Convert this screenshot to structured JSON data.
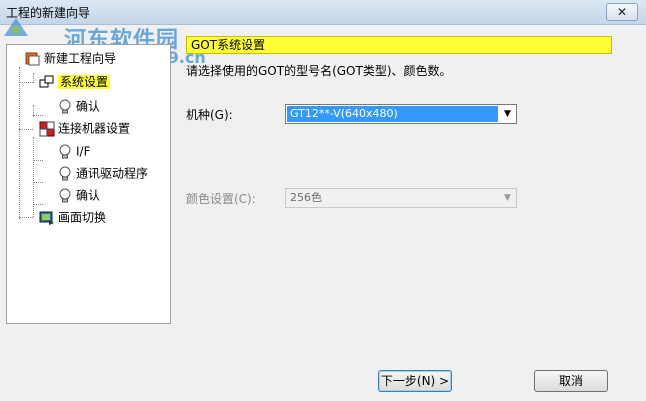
{
  "window": {
    "title": "工程的新建向导",
    "close_glyph": "✕"
  },
  "watermark": {
    "text": "河东软件园",
    "url": "www.pc0359.cn"
  },
  "tree": {
    "items": [
      {
        "label": "新建工程向导",
        "icon": "wizard-icon"
      },
      {
        "label": "系统设置",
        "icon": "system-settings-icon",
        "selected": true
      },
      {
        "label": "确认",
        "icon": "lightbulb-icon"
      },
      {
        "label": "连接机器设置",
        "icon": "connection-icon"
      },
      {
        "label": "I/F",
        "icon": "lightbulb-icon"
      },
      {
        "label": "通讯驱动程序",
        "icon": "lightbulb-icon"
      },
      {
        "label": "确认",
        "icon": "lightbulb-icon"
      },
      {
        "label": "画面切换",
        "icon": "screen-switch-icon"
      }
    ]
  },
  "panel": {
    "header": "GOT系统设置",
    "description": "请选择使用的GOT的型号名(GOT类型)、颜色数。",
    "model_label": "机种(G):",
    "model_value": "GT12**-V(640x480)",
    "color_label": "颜色设置(C):",
    "color_value": "256色"
  },
  "buttons": {
    "next": "下一步(N) >",
    "cancel": "取消"
  }
}
